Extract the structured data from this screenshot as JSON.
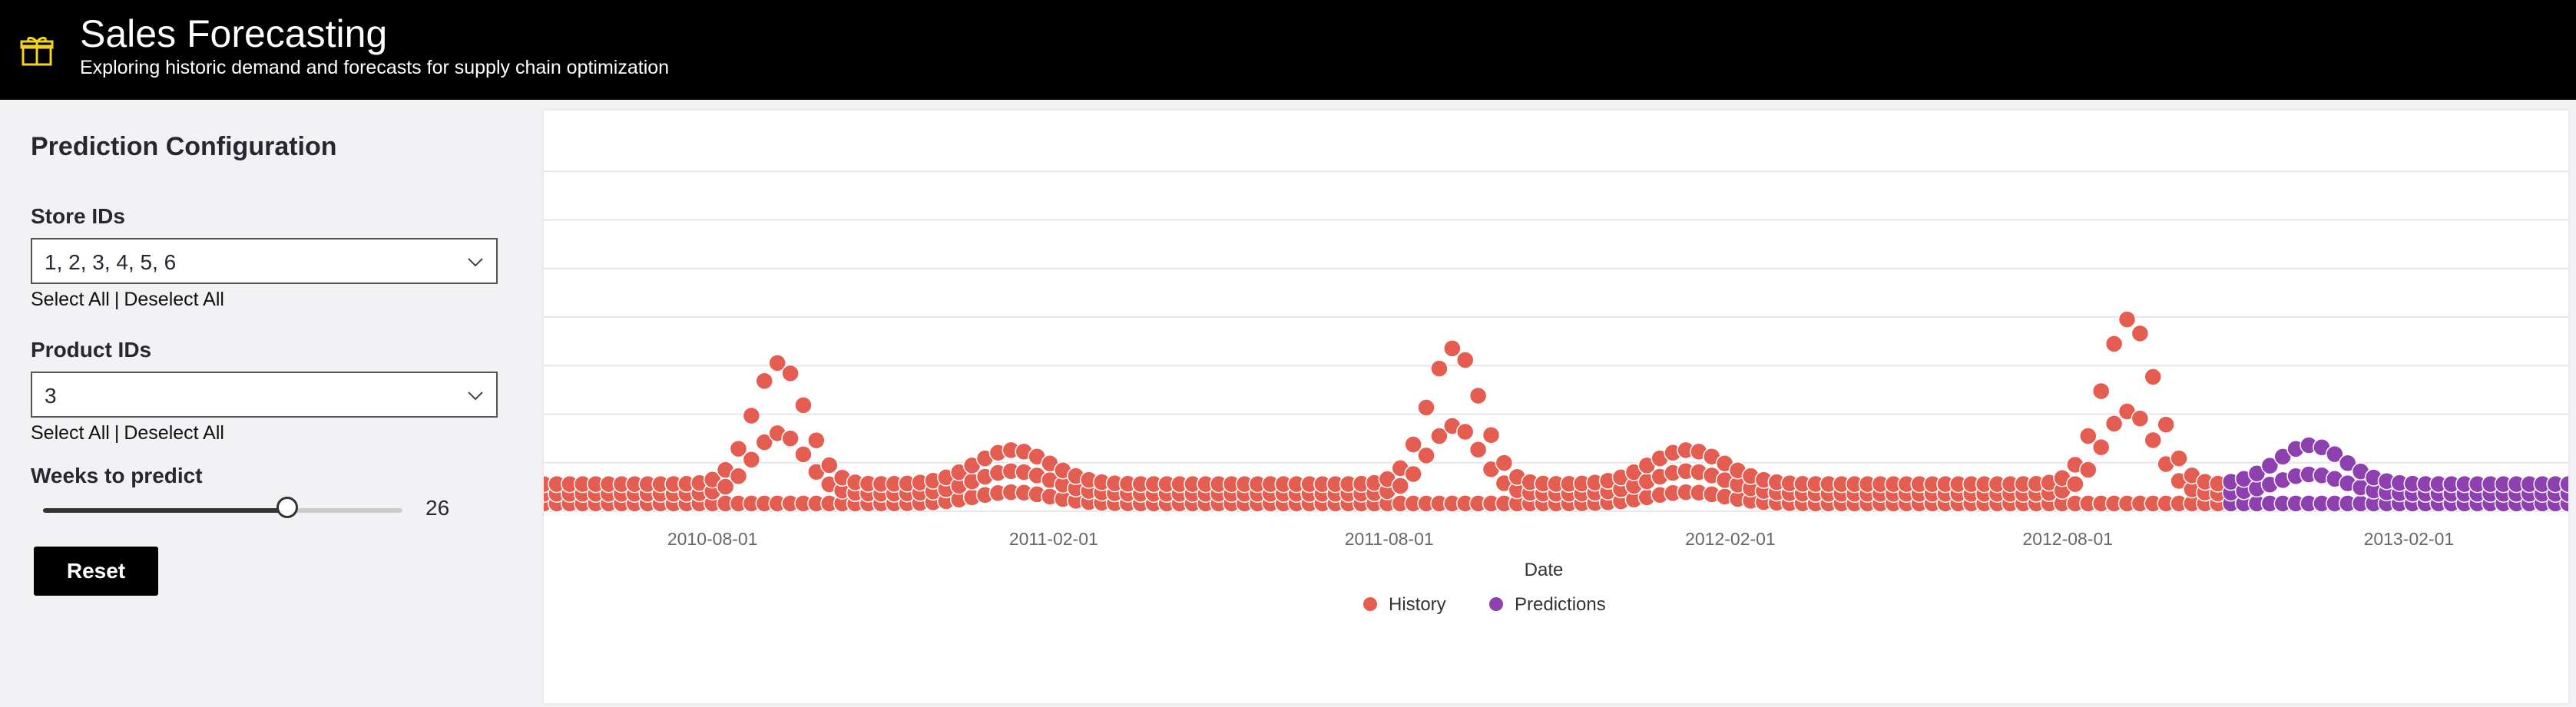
{
  "header": {
    "title": "Sales Forecasting",
    "subtitle": "Exploring historic demand and forecasts for supply chain optimization",
    "logo_icon": "gift-icon",
    "logo_color": "#f2d51b"
  },
  "sidebar": {
    "title": "Prediction Configuration",
    "store_ids": {
      "label": "Store IDs",
      "value": "1, 2, 3, 4, 5, 6",
      "select_all": "Select All",
      "separator": "|",
      "deselect_all": "Deselect All"
    },
    "product_ids": {
      "label": "Product IDs",
      "value": "3",
      "select_all": "Select All",
      "separator": "|",
      "deselect_all": "Deselect All"
    },
    "weeks": {
      "label": "Weeks to predict",
      "value": "26",
      "slider_fraction": 0.68
    },
    "reset_label": "Reset"
  },
  "chart_data": {
    "type": "scatter",
    "xlabel": "Date",
    "x_ticks": [
      "2010-08-01",
      "2011-02-01",
      "2011-08-01",
      "2012-02-01",
      "2012-08-01",
      "2013-02-01"
    ],
    "ylim": [
      0,
      400
    ],
    "y_gridlines": [
      0,
      50,
      100,
      150,
      200,
      250,
      300,
      350
    ],
    "x_range": [
      "2010-05-02",
      "2013-04-28"
    ],
    "history_end": "2012-10-26",
    "legend": [
      {
        "name": "History",
        "color": "#e45d50"
      },
      {
        "name": "Predictions",
        "color": "#8e3fb0"
      }
    ],
    "series": [
      {
        "name": "History",
        "color": "#e45d50",
        "description_free": true,
        "base_levels": [
          8,
          18,
          28
        ],
        "peaks": [
          {
            "center": "2010-09-06",
            "height": 125,
            "width_days": 28
          },
          {
            "center": "2011-09-05",
            "height": 140,
            "width_days": 28
          },
          {
            "center": "2012-09-03",
            "height": 170,
            "width_days": 28
          }
        ],
        "bumps": [
          {
            "center": "2011-01-10",
            "height": 35,
            "width_days": 30
          },
          {
            "center": "2012-01-09",
            "height": 35,
            "width_days": 30
          }
        ]
      },
      {
        "name": "Predictions",
        "color": "#8e3fb0",
        "start": "2012-10-28",
        "end": "2013-04-28",
        "base_levels": [
          8,
          18,
          28
        ],
        "peak": {
          "center": "2012-12-10",
          "height": 40
        }
      }
    ]
  }
}
